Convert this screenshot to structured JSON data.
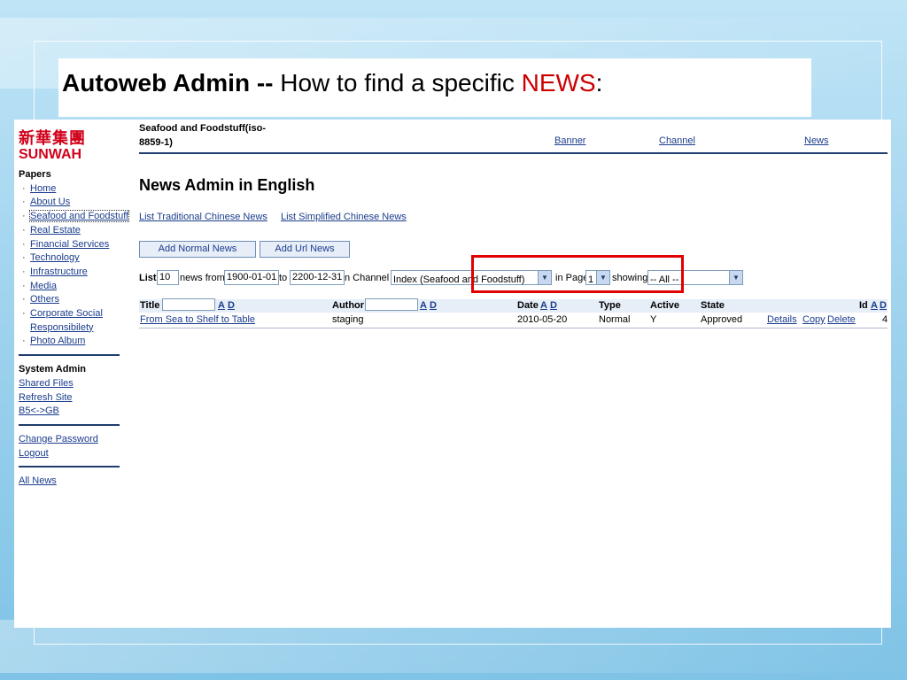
{
  "slide": {
    "title_bold": "Autoweb Admin --",
    "title_plain": " How to find a specific ",
    "title_red": "NEWS",
    "title_colon": ":"
  },
  "sidebar": {
    "logo_cn": "新華集團",
    "logo_en": "SUNWAH",
    "papers_heading": "Papers",
    "papers": [
      {
        "label": "Home"
      },
      {
        "label": "About Us"
      },
      {
        "label": "Seafood and Foodstuff"
      },
      {
        "label": "Real Estate"
      },
      {
        "label": "Financial Services"
      },
      {
        "label": "Technology"
      },
      {
        "label": "Infrastructure"
      },
      {
        "label": "Media"
      },
      {
        "label": "Others"
      },
      {
        "label": "Corporate Social"
      },
      {
        "label": "Responsibilety"
      },
      {
        "label": "Photo Album"
      }
    ],
    "system_heading": "System Admin",
    "system_links": [
      "Shared Files",
      "Refresh Site",
      "B5<->GB"
    ],
    "account_links": [
      "Change Password",
      "Logout"
    ],
    "all_news": "All News"
  },
  "header": {
    "site_name_line1": "Seafood and Foodstuff(iso-",
    "site_name_line2": "8859-1)",
    "links": [
      "Banner",
      "Channel",
      "News"
    ]
  },
  "main": {
    "heading": "News Admin in English",
    "sub_links": [
      "List Traditional Chinese News",
      "List Simplified Chinese News"
    ],
    "buttons": [
      "Add Normal News",
      "Add Url News"
    ]
  },
  "filter": {
    "list_label": "List",
    "list_count": "10",
    "news_from_label": "news from",
    "date_from": "1900-01-01",
    "to_label": "to",
    "date_to": "2200-12-31",
    "channel_label": "n Channel",
    "channel_value": "Index (Seafood and Foodstuff)",
    "page_label": "in Page",
    "page_value": "1",
    "showing_label": "showing",
    "showing_value": "-- All --"
  },
  "table": {
    "headers": {
      "title": "Title",
      "author": "Author",
      "date": "Date",
      "type": "Type",
      "active": "Active",
      "state": "State",
      "id": "Id"
    },
    "sort_asc": "A",
    "sort_desc": "D",
    "rows": [
      {
        "title": "From Sea to Shelf to Table",
        "author": "staging",
        "date": "2010-05-20",
        "type": "Normal",
        "active": "Y",
        "state": "Approved",
        "details": "Details",
        "copy": "Copy",
        "delete": "Delete",
        "id": "4"
      }
    ]
  },
  "colors": {
    "highlight": "#e00000",
    "brand_red": "#d0021b",
    "link": "#1a3c8c"
  }
}
